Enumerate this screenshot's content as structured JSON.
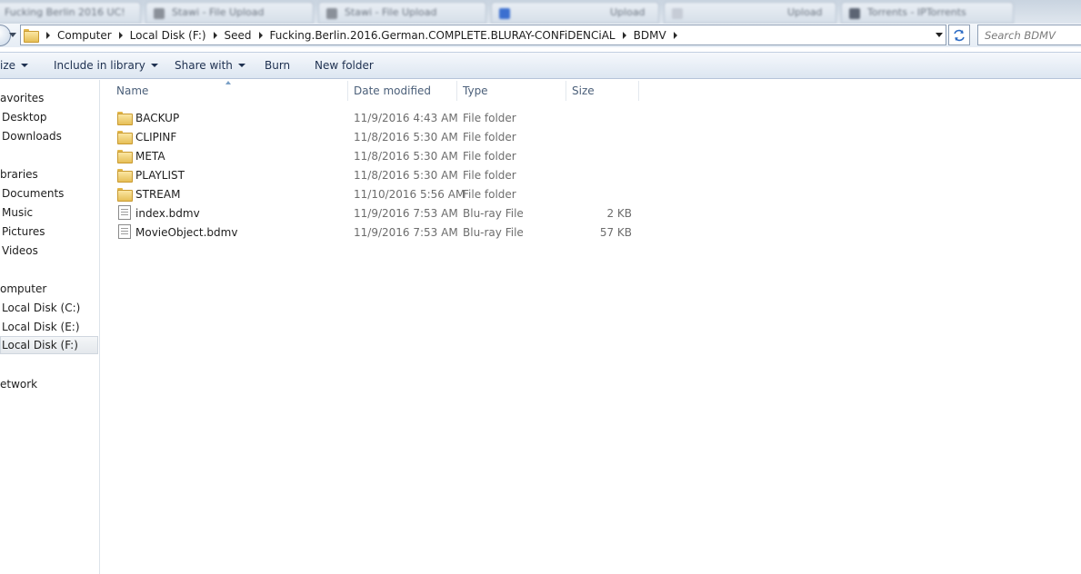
{
  "tabs": [
    {
      "label": "Fucking Berlin 2016 UC!",
      "favicon_color": "#7f8fa8"
    },
    {
      "label": "Stawi - File Upload",
      "favicon_color": "#8a9099"
    },
    {
      "label": "Stawi - File Upload",
      "favicon_color": "#8a9099"
    },
    {
      "label": "",
      "favicon_color": "#3b6fd0"
    },
    {
      "label": "Upload",
      "favicon_color": "#c6ccd6"
    },
    {
      "label": "Upload",
      "favicon_color": "#c6ccd6"
    },
    {
      "label": "Torrents - IPTorrents",
      "favicon_color": "#5b6473"
    }
  ],
  "address": {
    "crumbs": [
      "Computer",
      "Local Disk (F:)",
      "Seed",
      "Fucking.Berlin.2016.German.COMPLETE.BLURAY-CONFiDENCiAL",
      "BDMV"
    ],
    "search_placeholder": "Search BDMV"
  },
  "toolbar": {
    "organize": "ize",
    "include_in_library": "Include in library",
    "share_with": "Share with",
    "burn": "Burn",
    "new_folder": "New folder"
  },
  "nav": {
    "favorites": "avorites",
    "desktop": "Desktop",
    "downloads": "Downloads",
    "libraries": "braries",
    "documents": "Documents",
    "music": "Music",
    "pictures": "Pictures",
    "videos": "Videos",
    "computer": "omputer",
    "disk_c": "Local Disk (C:)",
    "disk_e": "Local Disk (E:)",
    "disk_f": "Local Disk (F:)",
    "network": "etwork"
  },
  "columns": {
    "name": "Name",
    "date_modified": "Date modified",
    "type": "Type",
    "size": "Size"
  },
  "files": [
    {
      "name": "BACKUP",
      "date": "11/9/2016 4:43 AM",
      "type": "File folder",
      "size": "",
      "kind": "folder"
    },
    {
      "name": "CLIPINF",
      "date": "11/8/2016 5:30 AM",
      "type": "File folder",
      "size": "",
      "kind": "folder"
    },
    {
      "name": "META",
      "date": "11/8/2016 5:30 AM",
      "type": "File folder",
      "size": "",
      "kind": "folder"
    },
    {
      "name": "PLAYLIST",
      "date": "11/8/2016 5:30 AM",
      "type": "File folder",
      "size": "",
      "kind": "folder"
    },
    {
      "name": "STREAM",
      "date": "11/10/2016 5:56 AM",
      "type": "File folder",
      "size": "",
      "kind": "folder"
    },
    {
      "name": "index.bdmv",
      "date": "11/9/2016 7:53 AM",
      "type": "Blu-ray File",
      "size": "2 KB",
      "kind": "file"
    },
    {
      "name": "MovieObject.bdmv",
      "date": "11/9/2016 7:53 AM",
      "type": "Blu-ray File",
      "size": "57 KB",
      "kind": "file"
    }
  ]
}
